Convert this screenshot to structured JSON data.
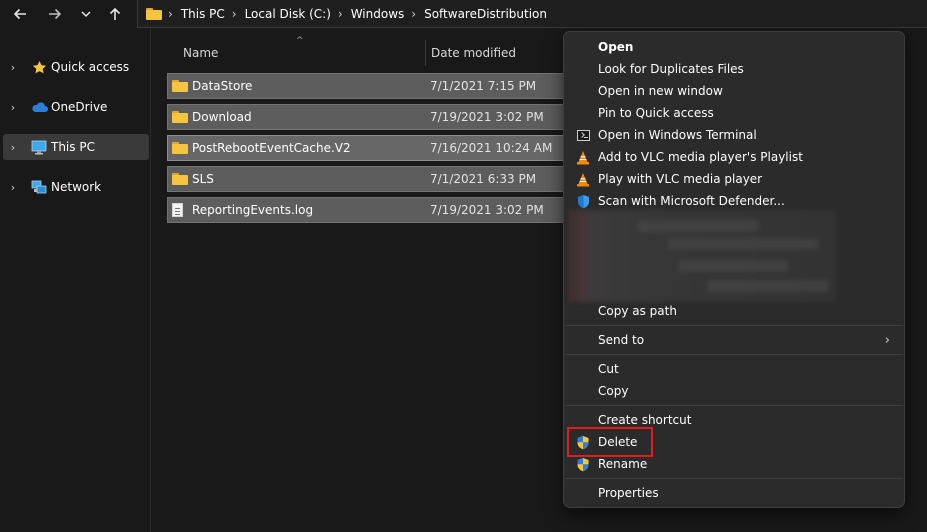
{
  "toolbar": {
    "back_icon": "arrow-left-icon",
    "forward_icon": "arrow-right-icon",
    "recent_icon": "chevron-down-icon",
    "up_icon": "arrow-up-icon"
  },
  "breadcrumb": [
    "This PC",
    "Local Disk (C:)",
    "Windows",
    "SoftwareDistribution"
  ],
  "nav": {
    "items": [
      {
        "label": "Quick access",
        "icon": "star-icon"
      },
      {
        "label": "OneDrive",
        "icon": "cloud-icon"
      },
      {
        "label": "This PC",
        "icon": "monitor-icon"
      },
      {
        "label": "Network",
        "icon": "network-icon"
      }
    ]
  },
  "columns": {
    "name": "Name",
    "date": "Date modified"
  },
  "files": [
    {
      "name": "DataStore",
      "date": "7/1/2021 7:15 PM",
      "type": "folder"
    },
    {
      "name": "Download",
      "date": "7/19/2021 3:02 PM",
      "type": "folder"
    },
    {
      "name": "PostRebootEventCache.V2",
      "date": "7/16/2021 10:24 AM",
      "type": "folder"
    },
    {
      "name": "SLS",
      "date": "7/1/2021 6:33 PM",
      "type": "folder"
    },
    {
      "name": "ReportingEvents.log",
      "date": "7/19/2021 3:02 PM",
      "type": "file"
    }
  ],
  "context_menu": {
    "items": [
      {
        "label": "Open",
        "icon": ""
      },
      {
        "label": "Look for Duplicates Files",
        "icon": ""
      },
      {
        "label": "Open in new window",
        "icon": ""
      },
      {
        "label": "Pin to Quick access",
        "icon": ""
      },
      {
        "label": "Open in Windows Terminal",
        "icon": "terminal-icon"
      },
      {
        "label": "Add to VLC media player's Playlist",
        "icon": "vlc-icon"
      },
      {
        "label": "Play with VLC media player",
        "icon": "vlc-icon"
      },
      {
        "label": "Scan with Microsoft Defender...",
        "icon": "defender-shield-icon"
      },
      {
        "label": "Copy as path",
        "icon": ""
      },
      {
        "label": "Send to",
        "icon": "",
        "submenu": true
      },
      {
        "label": "Cut",
        "icon": ""
      },
      {
        "label": "Copy",
        "icon": ""
      },
      {
        "label": "Create shortcut",
        "icon": ""
      },
      {
        "label": "Delete",
        "icon": "uac-shield-icon"
      },
      {
        "label": "Rename",
        "icon": "uac-shield-icon"
      },
      {
        "label": "Properties",
        "icon": ""
      }
    ],
    "highlighted_item": "Delete",
    "highlight_color": "#e21b1b"
  }
}
